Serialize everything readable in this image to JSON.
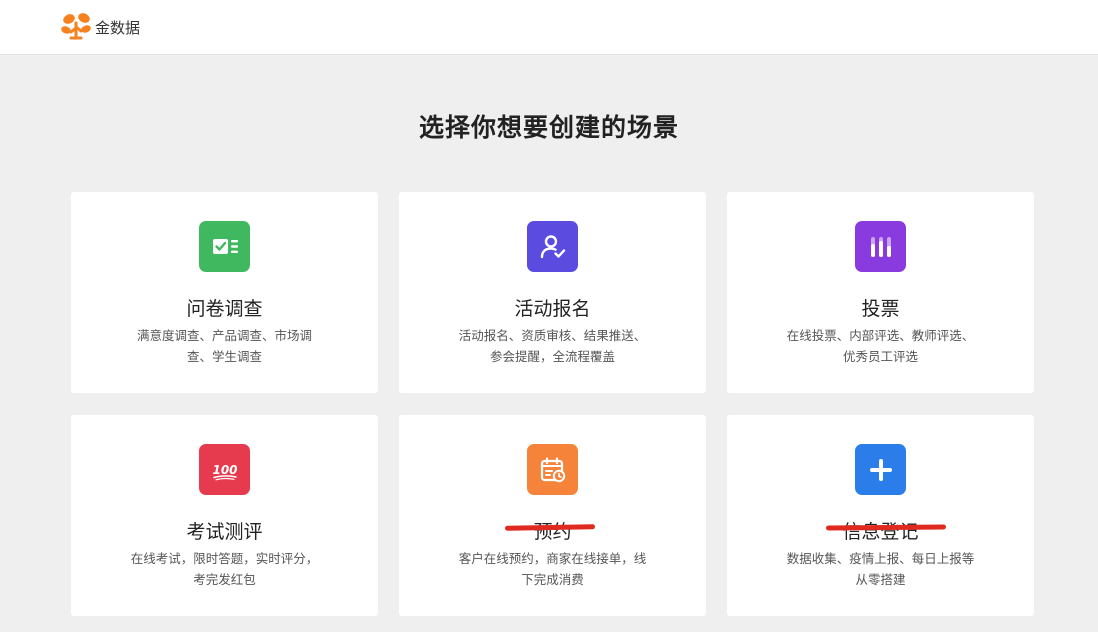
{
  "header": {
    "logo_text": "金数据",
    "logo_colors": {
      "orange": "#f5821f"
    }
  },
  "page": {
    "title": "选择你想要创建的场景"
  },
  "cards": [
    {
      "title": "问卷调查",
      "desc_line1": "满意度调查、产品调查、市场调",
      "desc_line2": "查、学生调查",
      "icon": "survey-checkbox-icon",
      "color": "#3fb85f"
    },
    {
      "title": "活动报名",
      "desc_line1": "活动报名、资质审核、结果推送、",
      "desc_line2": "参会提醒，全流程覆盖",
      "icon": "user-check-icon",
      "color": "#5b4bdf"
    },
    {
      "title": "投票",
      "desc_line1": "在线投票、内部评选、教师评选、",
      "desc_line2": "优秀员工评选",
      "icon": "vote-bars-icon",
      "color": "#8a3be0"
    },
    {
      "title": "考试测评",
      "desc_line1": "在线考试，限时答题，实时评分，",
      "desc_line2": "考完发红包",
      "icon": "score-100-icon",
      "icon_text": "100",
      "color": "#e63a4e"
    },
    {
      "title": "预约",
      "desc_line1": "客户在线预约，商家在线接单，线",
      "desc_line2": "下完成消费",
      "icon": "calendar-clock-icon",
      "color": "#f5843a"
    },
    {
      "title": "信息登记",
      "desc_line1": "数据收集、疫情上报、每日上报等",
      "desc_line2": "从零搭建",
      "icon": "plus-icon",
      "color": "#2b7de9"
    }
  ],
  "annotation": {
    "strike_color": "#e02a1f"
  }
}
